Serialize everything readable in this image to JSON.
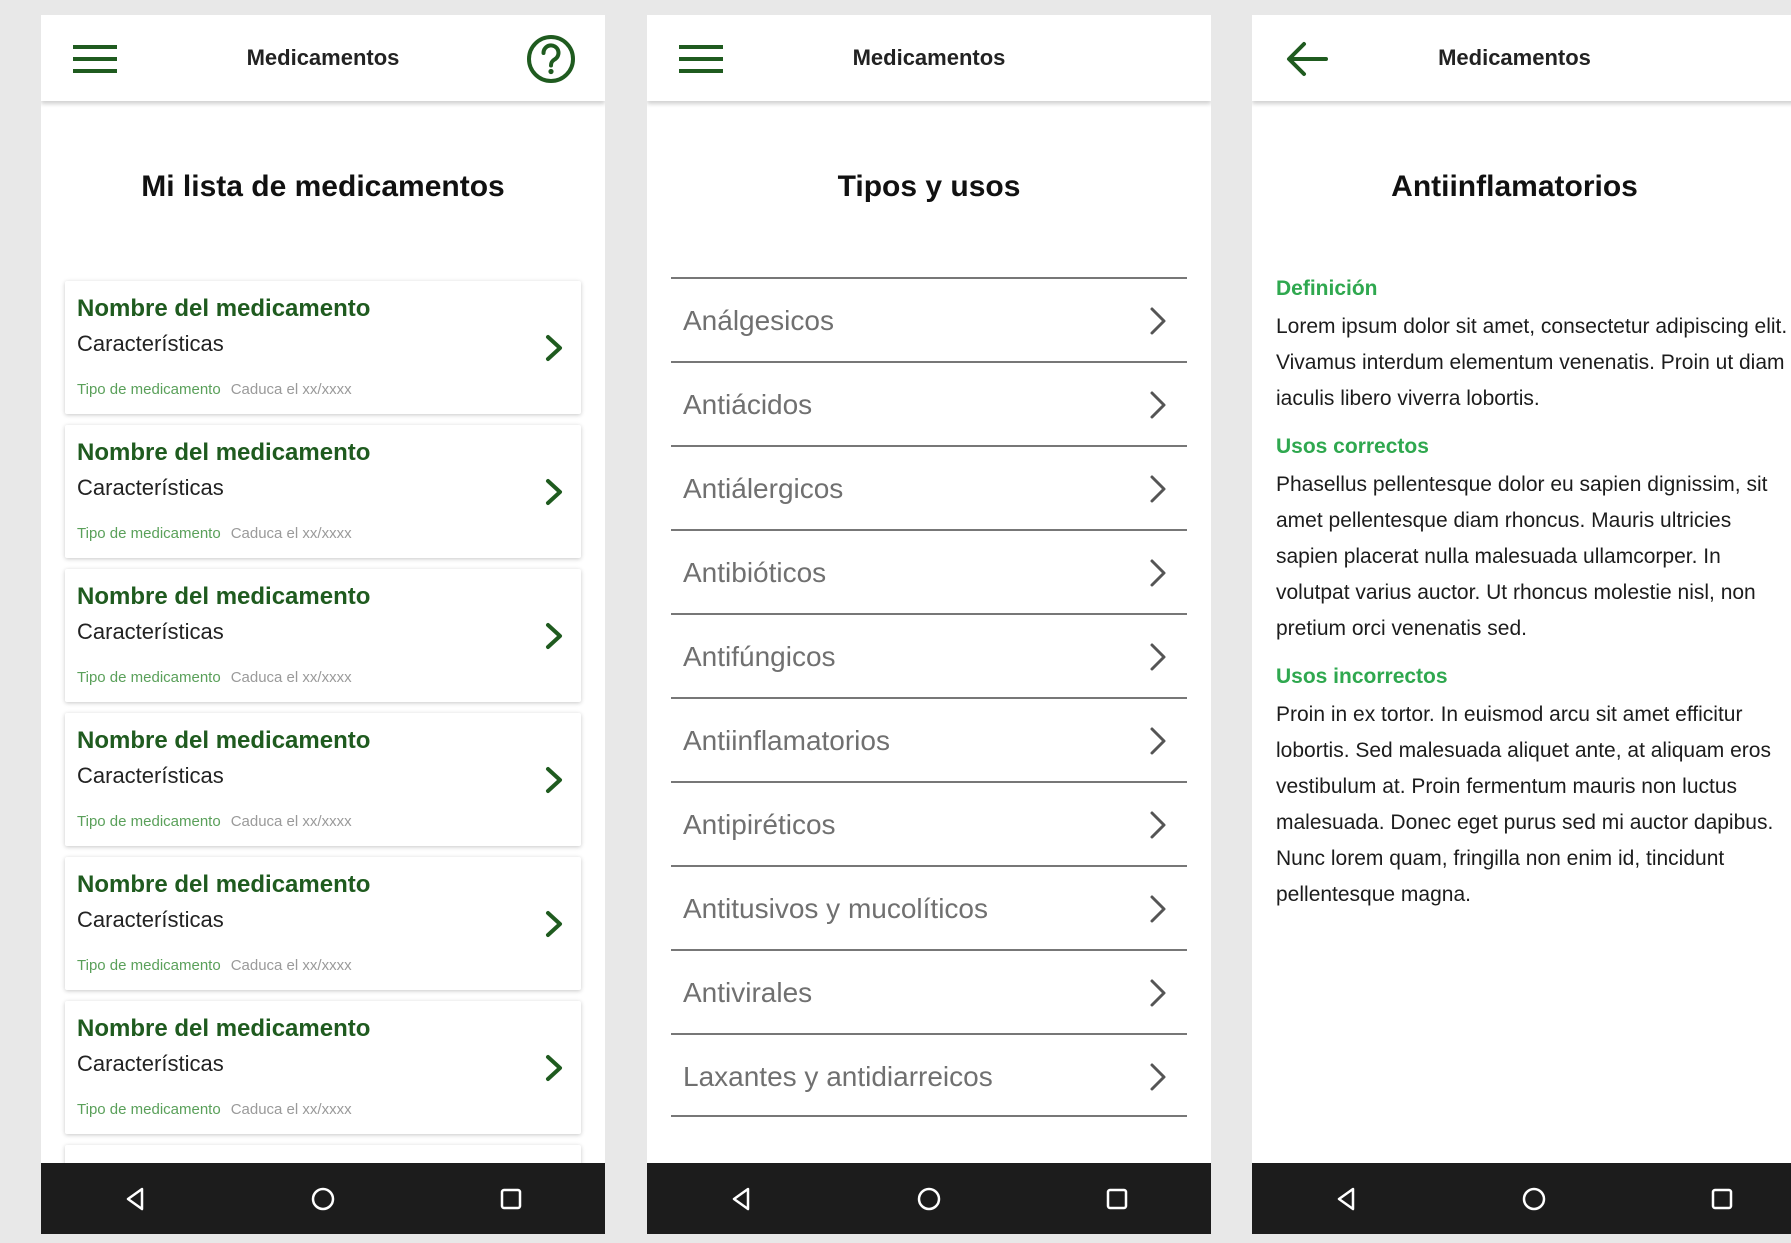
{
  "colors": {
    "brand_green": "#1f5b1f",
    "accent_green": "#2fa84f",
    "navbar": "#1c1c1c"
  },
  "screen1": {
    "appbar_title": "Medicamentos",
    "menu_icon": "hamburger-menu-icon",
    "help_icon": "help-circle-icon",
    "heading": "Mi lista de medicamentos",
    "cards": [
      {
        "name": "Nombre del medicamento",
        "features": "Características",
        "type": "Tipo de medicamento",
        "expiry": "Caduca el xx/xxxx"
      },
      {
        "name": "Nombre del medicamento",
        "features": "Características",
        "type": "Tipo de medicamento",
        "expiry": "Caduca el xx/xxxx"
      },
      {
        "name": "Nombre del medicamento",
        "features": "Características",
        "type": "Tipo de medicamento",
        "expiry": "Caduca el xx/xxxx"
      },
      {
        "name": "Nombre del medicamento",
        "features": "Características",
        "type": "Tipo de medicamento",
        "expiry": "Caduca el xx/xxxx"
      },
      {
        "name": "Nombre del medicamento",
        "features": "Características",
        "type": "Tipo de medicamento",
        "expiry": "Caduca el xx/xxxx"
      },
      {
        "name": "Nombre del medicamento",
        "features": "Características",
        "type": "Tipo de medicamento",
        "expiry": "Caduca el xx/xxxx"
      }
    ]
  },
  "screen2": {
    "appbar_title": "Medicamentos",
    "menu_icon": "hamburger-menu-icon",
    "heading": "Tipos y usos",
    "categories": [
      "Análgesicos",
      "Antiácidos",
      "Antiálergicos",
      "Antibióticos",
      "Antifúngicos",
      "Antiinflamatorios",
      "Antipiréticos",
      "Antitusivos y mucolíticos",
      "Antivirales",
      "Laxantes y antidiarreicos"
    ]
  },
  "screen3": {
    "appbar_title": "Medicamentos",
    "back_icon": "arrow-back-icon",
    "heading": "Antiinflamatorios",
    "sections": [
      {
        "title": "Definición",
        "body": "Lorem ipsum dolor sit amet, consectetur adipiscing elit. Vivamus interdum elementum venenatis. Proin ut diam iaculis libero viverra lobortis."
      },
      {
        "title": "Usos correctos",
        "body": "Phasellus pellentesque dolor eu sapien dignissim, sit amet pellentesque diam rhoncus. Mauris ultricies sapien placerat nulla malesuada ullamcorper. In volutpat varius auctor. Ut rhoncus molestie nisl, non pretium orci venenatis sed."
      },
      {
        "title": "Usos incorrectos",
        "body": "Proin in ex tortor. In euismod arcu sit amet efficitur lobortis. Sed malesuada aliquet ante, at aliquam eros vestibulum at. Proin fermentum mauris non luctus malesuada. Donec eget purus sed mi auctor dapibus. Nunc lorem quam, fringilla non enim id, tincidunt pellentesque magna."
      }
    ]
  },
  "navbar_icons": [
    "nav-back-triangle-icon",
    "nav-home-circle-icon",
    "nav-recents-square-icon"
  ]
}
